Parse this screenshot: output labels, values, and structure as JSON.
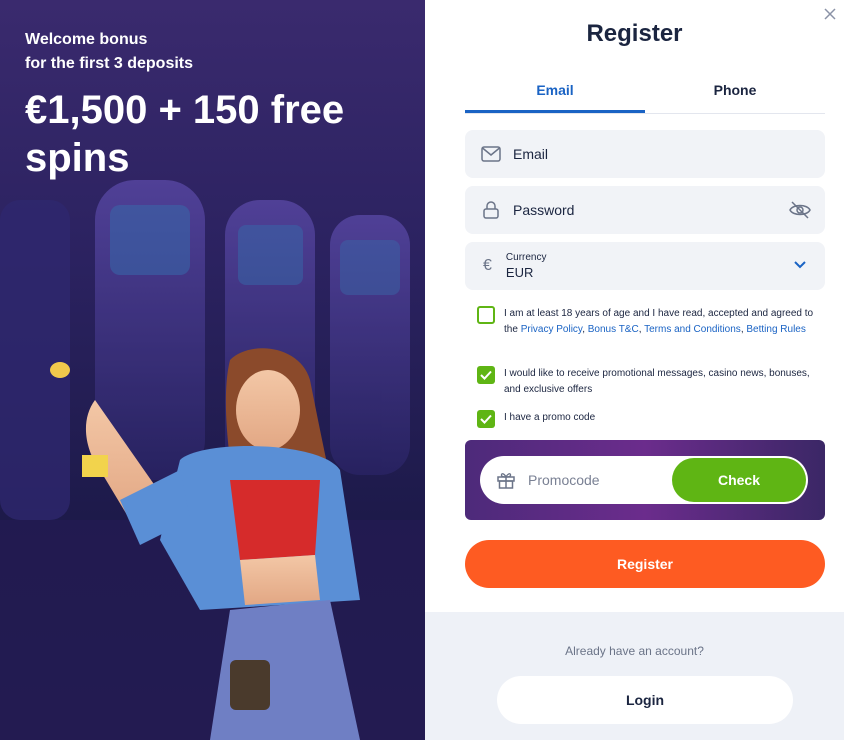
{
  "promo": {
    "subtitle_line1": "Welcome bonus",
    "subtitle_line2": "for the first 3 deposits",
    "headline": "€1,500 + 150 free spins"
  },
  "form": {
    "title": "Register",
    "tabs": [
      {
        "label": "Email",
        "active": true
      },
      {
        "label": "Phone",
        "active": false
      }
    ],
    "email_placeholder": "Email",
    "password_placeholder": "Password",
    "currency": {
      "label": "Currency",
      "value": "EUR",
      "symbol": "€"
    },
    "checkboxes": [
      {
        "checked": false,
        "text_before": "I am at least 18 years of age and I have read, accepted and agreed to the ",
        "links": [
          "Privacy Policy",
          "Bonus T&C",
          "Terms and Conditions",
          "Betting Rules"
        ]
      },
      {
        "checked": true,
        "text": "I would like to receive promotional messages, casino news, bonuses, and exclusive offers"
      },
      {
        "checked": true,
        "text": "I have a promo code"
      }
    ],
    "promocode_placeholder": "Promocode",
    "check_button": "Check",
    "register_button": "Register"
  },
  "footer": {
    "question": "Already have an account?",
    "login_button": "Login"
  },
  "colors": {
    "accent_blue": "#1a63c4",
    "green": "#5fb514",
    "orange": "#fe5b22",
    "dark_text": "#1b2540"
  }
}
